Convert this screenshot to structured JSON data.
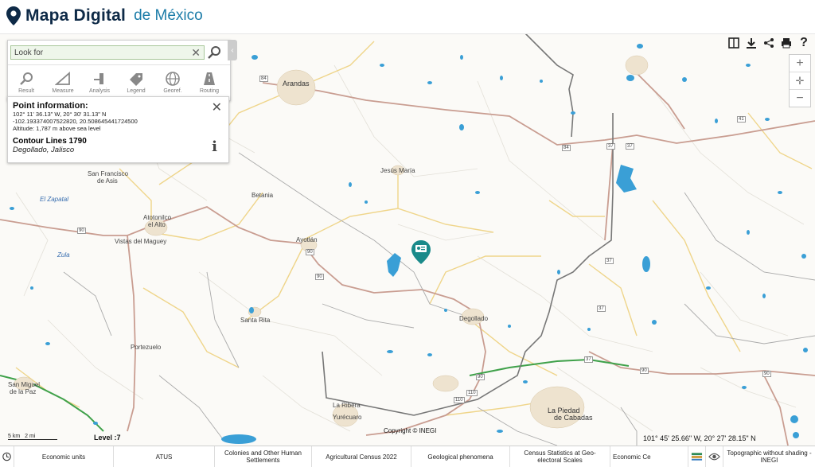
{
  "header": {
    "title_bold": "Mapa Digital",
    "title_light": "de México"
  },
  "search": {
    "placeholder": "Look for"
  },
  "tools": [
    "Result",
    "Measure",
    "Analysis",
    "Legend",
    "Georef.",
    "Routing"
  ],
  "info": {
    "heading": "Point information:",
    "dms": "102° 11' 36.13\" W, 20° 30' 31.13\" N",
    "decimal": "-102.193374007522820, 20.508645441724500",
    "altitude": "Altitude: 1,787 m above sea level",
    "contour": "Contour Lines 1790",
    "location": "Degollado, Jalisco"
  },
  "map": {
    "places": {
      "arandas": "Arandas",
      "san_francisco": "San Francisco",
      "de_asis": "de Asis",
      "el_zapatal": "El Zapatal",
      "betania": "Betania",
      "jesus_maria": "Jesús María",
      "atotonilco": "Atotonilco",
      "el_alto": "el Alto",
      "vistas": "Vistas del Maguey",
      "ayotlan": "Ayotlán",
      "zula": "Zula",
      "santa_rita": "Santa Rita",
      "degollado": "Degollado",
      "portezuelo": "Portezuelo",
      "san_miguel": "San Miguel",
      "de_la_paz": "de la Paz",
      "la_ribera": "La Ribera",
      "yurecuaro": "Yurécuaro",
      "la_piedad": "La Piedad",
      "de_cabadas": "de Cabadas"
    },
    "shields": [
      "84",
      "90",
      "90",
      "90",
      "90",
      "90",
      "84",
      "37",
      "37",
      "37",
      "41",
      "110",
      "110",
      "90",
      "37",
      "37"
    ],
    "scale_km": "5 km",
    "scale_mi": "2 mi",
    "level": "Level :7",
    "copyright": "Copyright © INEGI",
    "coords": "101° 45' 25.66\" W, 20° 27' 28.15\" N"
  },
  "bottom_tabs": [
    "Economic units",
    "ATUS",
    "Colonies and Other Human Settlements",
    "Agricultural Census 2022",
    "Geological phenomena",
    "Census Statistics at Geo-electoral Scales",
    "Economic Ce",
    "Topographic without shading - INEGI"
  ],
  "colors": {
    "brand": "#0e2a47",
    "accent": "#1c7ca8",
    "water": "#3a9fd6",
    "highway": "#c89b8f",
    "road": "#f0d889",
    "boundary": "#7a7a7a",
    "green_road": "#3fa14a",
    "marker": "#1a8a8a"
  }
}
